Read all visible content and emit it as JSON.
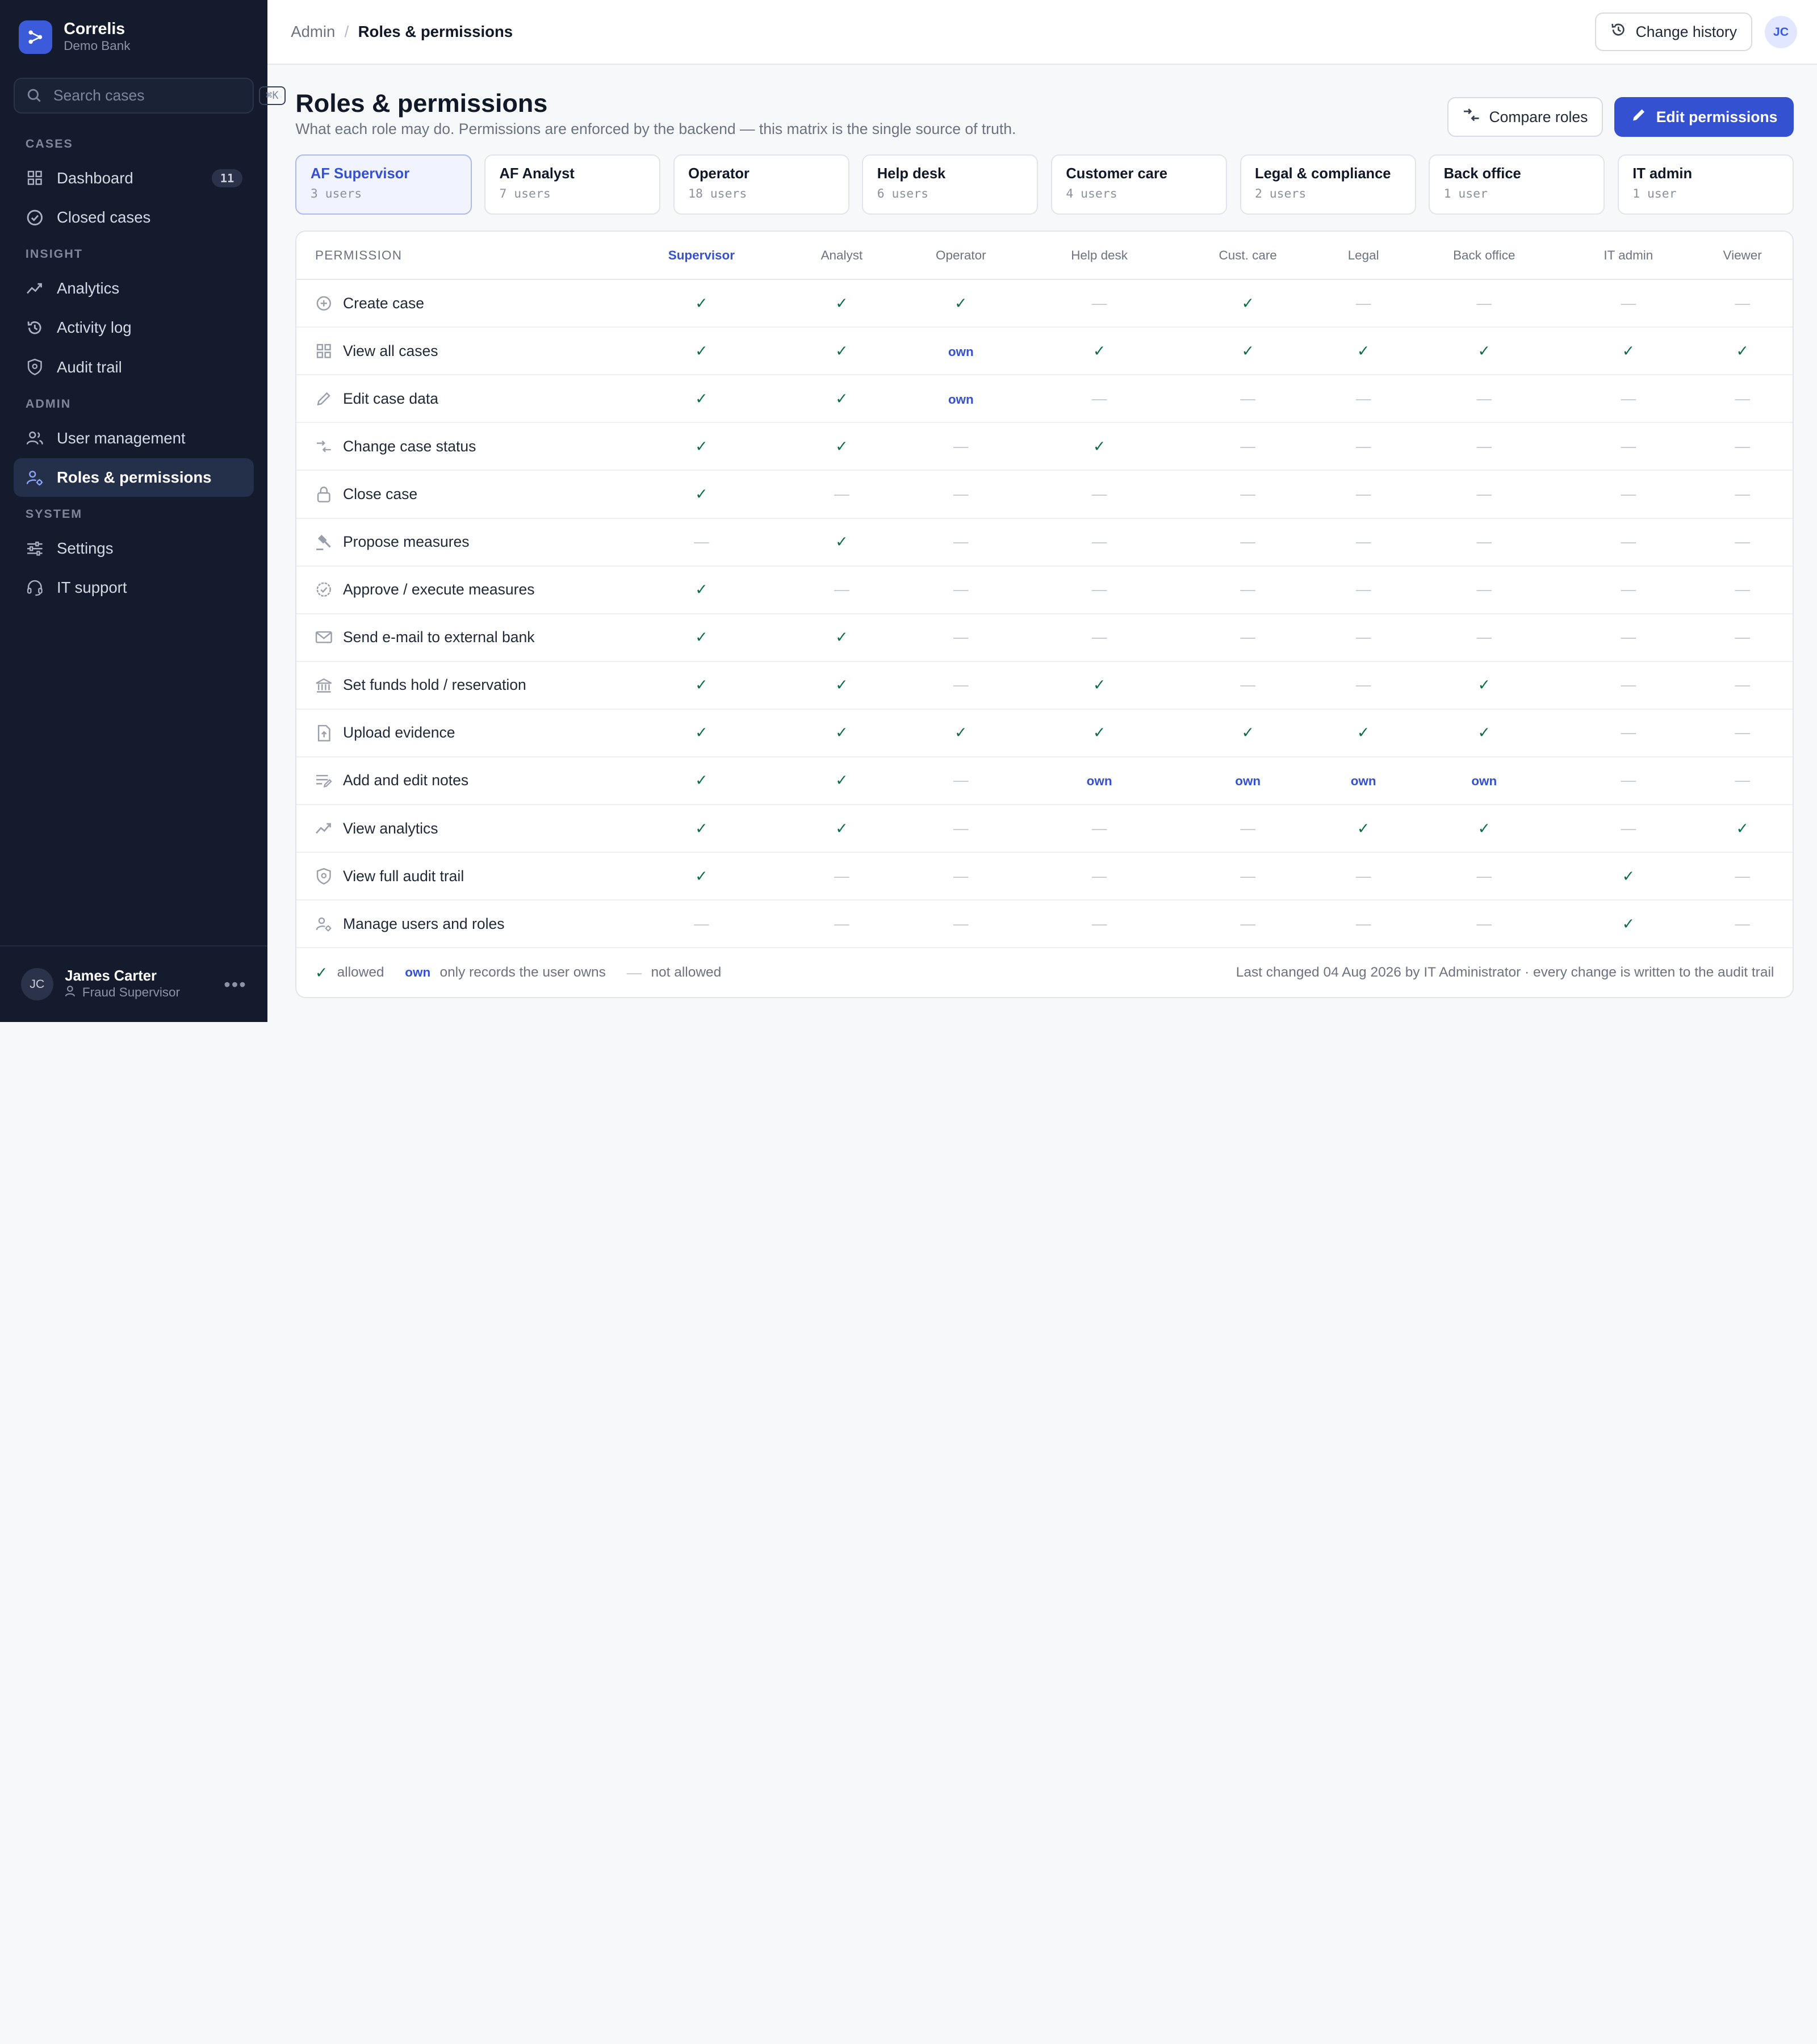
{
  "brand": {
    "name": "Correlis",
    "sub": "Demo Bank"
  },
  "search": {
    "placeholder": "Search cases",
    "shortcut": "⌘K"
  },
  "sidebar": {
    "sections": [
      {
        "title": "CASES",
        "items": [
          {
            "label": "Dashboard",
            "icon": "grid-icon",
            "badge": "11"
          },
          {
            "label": "Closed cases",
            "icon": "check-circle-icon"
          }
        ]
      },
      {
        "title": "INSIGHT",
        "items": [
          {
            "label": "Analytics",
            "icon": "trend-icon"
          },
          {
            "label": "Activity log",
            "icon": "history-icon"
          },
          {
            "label": "Audit trail",
            "icon": "shield-icon"
          }
        ]
      },
      {
        "title": "ADMIN",
        "items": [
          {
            "label": "User management",
            "icon": "users-icon"
          },
          {
            "label": "Roles & permissions",
            "icon": "user-gear-icon",
            "active": true
          }
        ]
      },
      {
        "title": "SYSTEM",
        "items": [
          {
            "label": "Settings",
            "icon": "sliders-icon"
          },
          {
            "label": "IT support",
            "icon": "headset-icon"
          }
        ]
      }
    ]
  },
  "user": {
    "initials": "JC",
    "name": "James Carter",
    "role": "Fraud Supervisor"
  },
  "topbar": {
    "crumb_parent": "Admin",
    "crumb_current": "Roles & permissions",
    "history_label": "Change history",
    "avatar": "JC"
  },
  "page": {
    "title": "Roles & permissions",
    "subtitle": "What each role may do. Permissions are enforced by the backend — this matrix is the single source of truth.",
    "compare_label": "Compare roles",
    "edit_label": "Edit permissions"
  },
  "roles": [
    {
      "name": "AF Supervisor",
      "count": "3 users",
      "active": true
    },
    {
      "name": "AF Analyst",
      "count": "7 users"
    },
    {
      "name": "Operator",
      "count": "18 users"
    },
    {
      "name": "Help desk",
      "count": "6 users"
    },
    {
      "name": "Customer care",
      "count": "4 users"
    },
    {
      "name": "Legal & compliance",
      "count": "2 users"
    },
    {
      "name": "Back office",
      "count": "1 user"
    },
    {
      "name": "IT admin",
      "count": "1 user"
    }
  ],
  "matrix": {
    "permission_header": "PERMISSION",
    "columns": [
      "Supervisor",
      "Analyst",
      "Operator",
      "Help desk",
      "Cust. care",
      "Legal",
      "Back office",
      "IT admin",
      "Viewer"
    ],
    "active_column": 0,
    "rows": [
      {
        "label": "Create case",
        "icon": "plus-circle-icon",
        "values": [
          "y",
          "y",
          "y",
          "n",
          "y",
          "n",
          "n",
          "n",
          "n"
        ]
      },
      {
        "label": "View all cases",
        "icon": "grid-icon",
        "values": [
          "y",
          "y",
          "own",
          "y",
          "y",
          "y",
          "y",
          "y",
          "y"
        ]
      },
      {
        "label": "Edit case data",
        "icon": "pencil-icon",
        "values": [
          "y",
          "y",
          "own",
          "n",
          "n",
          "n",
          "n",
          "n",
          "n"
        ]
      },
      {
        "label": "Change case status",
        "icon": "swap-icon",
        "values": [
          "y",
          "y",
          "n",
          "y",
          "n",
          "n",
          "n",
          "n",
          "n"
        ]
      },
      {
        "label": "Close case",
        "icon": "lock-icon",
        "values": [
          "y",
          "n",
          "n",
          "n",
          "n",
          "n",
          "n",
          "n",
          "n"
        ]
      },
      {
        "label": "Propose measures",
        "icon": "gavel-icon",
        "values": [
          "n",
          "y",
          "n",
          "n",
          "n",
          "n",
          "n",
          "n",
          "n"
        ]
      },
      {
        "label": "Approve / execute measures",
        "icon": "badge-check-icon",
        "values": [
          "y",
          "n",
          "n",
          "n",
          "n",
          "n",
          "n",
          "n",
          "n"
        ]
      },
      {
        "label": "Send e-mail to external bank",
        "icon": "mail-icon",
        "values": [
          "y",
          "y",
          "n",
          "n",
          "n",
          "n",
          "n",
          "n",
          "n"
        ]
      },
      {
        "label": "Set funds hold / reservation",
        "icon": "bank-icon",
        "values": [
          "y",
          "y",
          "n",
          "y",
          "n",
          "n",
          "y",
          "n",
          "n"
        ]
      },
      {
        "label": "Upload evidence",
        "icon": "file-upload-icon",
        "values": [
          "y",
          "y",
          "y",
          "y",
          "y",
          "y",
          "y",
          "n",
          "n"
        ]
      },
      {
        "label": "Add and edit notes",
        "icon": "notes-icon",
        "values": [
          "y",
          "y",
          "n",
          "own",
          "own",
          "own",
          "own",
          "n",
          "n"
        ]
      },
      {
        "label": "View analytics",
        "icon": "trend-icon",
        "values": [
          "y",
          "y",
          "n",
          "n",
          "n",
          "y",
          "y",
          "n",
          "y"
        ]
      },
      {
        "label": "View full audit trail",
        "icon": "shield-icon",
        "values": [
          "y",
          "n",
          "n",
          "n",
          "n",
          "n",
          "n",
          "y",
          "n"
        ]
      },
      {
        "label": "Manage users and roles",
        "icon": "user-gear-icon",
        "values": [
          "n",
          "n",
          "n",
          "n",
          "n",
          "n",
          "n",
          "y",
          "n"
        ]
      }
    ],
    "symbols": {
      "y": "✓",
      "n": "—",
      "own": "own"
    }
  },
  "legend": {
    "allowed": "allowed",
    "own_tag": "own",
    "own_text": "only records the user owns",
    "not_allowed": "not allowed",
    "note": "Last changed 04 Aug 2026 by IT Administrator · every change is written to the audit trail"
  },
  "colors": {
    "sidebar": "#141b2d",
    "accent": "#3451d1",
    "check": "#0b6e46"
  }
}
